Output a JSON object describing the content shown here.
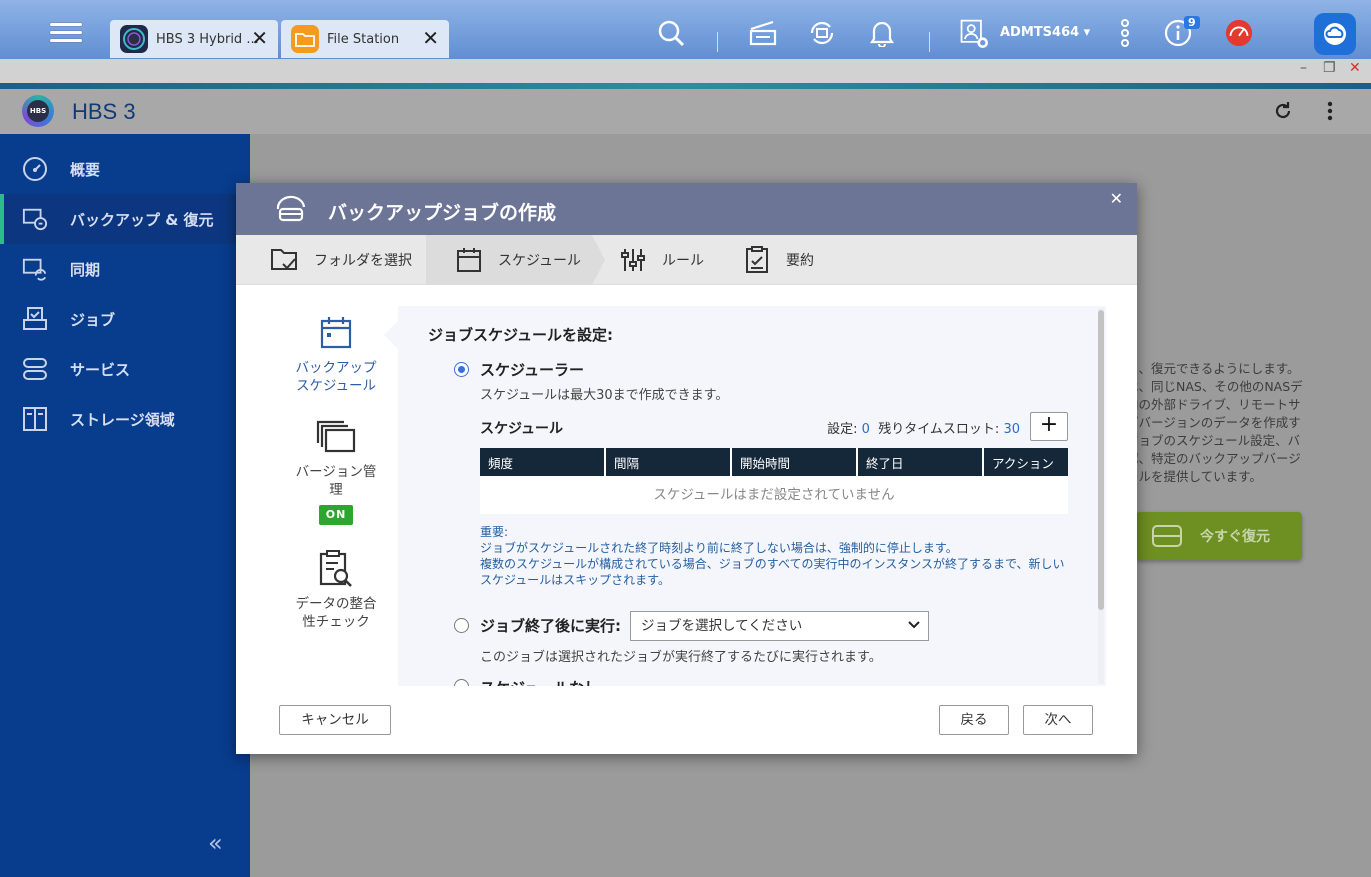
{
  "taskbar": {
    "tabs": [
      {
        "label": "HBS 3 Hybrid ...",
        "close": "✕"
      },
      {
        "label": "File Station",
        "close": "✕"
      }
    ],
    "user": "ADMTS464 ▾",
    "notification_count": "9"
  },
  "window_controls": {
    "minimize": "–",
    "maximize": "❐",
    "close": "✕"
  },
  "app": {
    "title": "HBS 3",
    "logo_text": "HBS"
  },
  "sidebar": {
    "items": [
      {
        "label": "概要",
        "icon": "dashboard-icon"
      },
      {
        "label": "バックアップ & 復元",
        "icon": "backup-restore-icon"
      },
      {
        "label": "同期",
        "icon": "sync-icon"
      },
      {
        "label": "ジョブ",
        "icon": "job-icon"
      },
      {
        "label": "サービス",
        "icon": "service-icon"
      },
      {
        "label": "ストレージ領域",
        "icon": "storage-icon"
      }
    ],
    "collapse": "«"
  },
  "background": {
    "lines": [
      "し、復元できるようにします。",
      "は、同じNAS、その他のNASデ",
      "内の外部ドライブ、リモートサ",
      "ブバージョンのデータを作成す",
      "ジョブのスケジュール設定、バ",
      "認、特定のバックアップバージ",
      "ールを提供しています。"
    ],
    "restore_button": "今すぐ復元"
  },
  "dialog": {
    "title": "バックアップジョブの作成",
    "close": "✕",
    "steps": [
      {
        "label": "フォルダを選択"
      },
      {
        "label": "スケジュール"
      },
      {
        "label": "ルール"
      },
      {
        "label": "要約"
      }
    ],
    "left_nav": {
      "schedule": "バックアップ スケジュール",
      "version": "バージョン管理",
      "version_badge": "ON",
      "integrity": "データの整合性チェック"
    },
    "panel": {
      "title": "ジョブスケジュールを設定:",
      "scheduler_label": "スケジューラー",
      "scheduler_desc": "スケジュールは最大30まで作成できます。",
      "schedule_header": "スケジュール",
      "set_label": "設定:",
      "set_value": "0",
      "remaining_label": "残りタイムスロット:",
      "remaining_value": "30",
      "add": "+",
      "columns": [
        "頻度",
        "間隔",
        "開始時間",
        "終了日",
        "アクション"
      ],
      "empty": "スケジュールはまだ設定されていません",
      "note_title": "重要:",
      "note_line1": "ジョブがスケジュールされた終了時刻より前に終了しない場合は、強制的に停止します。",
      "note_line2": "複数のスケジュールが構成されている場合、ジョブのすべての実行中のインスタンスが終了するまで、新しいスケジュールはスキップされます。",
      "after_job_label": "ジョブ終了後に実行:",
      "after_job_select": "ジョブを選択してください",
      "after_job_desc": "このジョブは選択されたジョブが実行終了するたびに実行されます。",
      "no_schedule_label": "スケジュールなし"
    },
    "buttons": {
      "cancel": "キャンセル",
      "back": "戻る",
      "next": "次へ"
    }
  }
}
